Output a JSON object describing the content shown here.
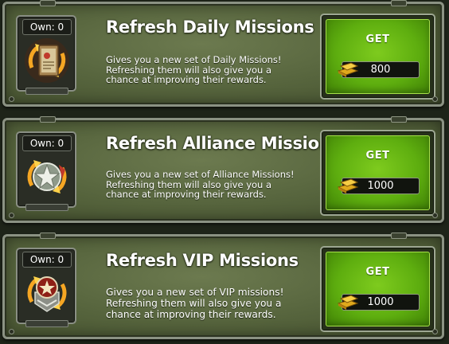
{
  "missions": [
    {
      "own_label": "Own: 0",
      "title": "Refresh Daily Missions",
      "desc_lines": [
        "Gives you a new set of Daily Missions!",
        "Refreshing them will also give you a",
        "chance at improving their rewards."
      ],
      "button_label": "GET",
      "cost": "800",
      "icon": "daily-missions-refresh-icon"
    },
    {
      "own_label": "Own: 0",
      "title": "Refresh Alliance Missions",
      "desc_lines": [
        "Gives you a new set of Alliance Missions!",
        "Refreshing them will also give you a",
        "chance at improving their rewards."
      ],
      "button_label": "GET",
      "cost": "1000",
      "icon": "alliance-missions-refresh-icon"
    },
    {
      "own_label": "Own: 0",
      "title": "Refresh VIP Missions",
      "desc_lines": [
        "Gives you a new set of VIP missions!",
        "Refreshing them will also give you a",
        "chance at improving their rewards."
      ],
      "button_label": "GET",
      "cost": "1000",
      "icon": "vip-missions-refresh-icon"
    }
  ],
  "currency_icon": "gold-bars-icon",
  "colors": {
    "button_green": "#6fbe17",
    "panel_green": "#5a6840",
    "text": "#ffffff"
  }
}
